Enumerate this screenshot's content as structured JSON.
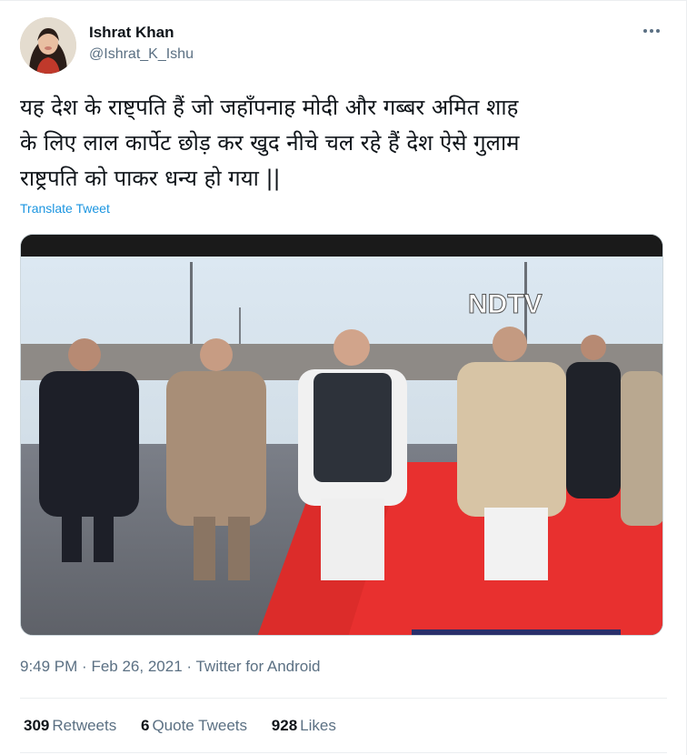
{
  "author": {
    "name": "Ishrat Khan",
    "handle": "@Ishrat_K_Ishu"
  },
  "tweet": {
    "line1": "यह देश के राष्ट्पति हैं जो जहाँपनाह मोदी और गब्बर अमित शाह",
    "line2": "के लिए लाल कार्पेट छोड़ कर खुद नीचे चल रहे हैं देश ऐसे गुलाम",
    "line3": "राष्ट्रपति को पाकर धन्य हो गया ||",
    "translate_label": "Translate Tweet"
  },
  "media": {
    "watermark": "NDTV"
  },
  "meta": {
    "time": "9:49 PM",
    "date": "Feb 26, 2021",
    "separator": "·",
    "source": "Twitter for Android"
  },
  "stats": {
    "retweets_count": "309",
    "retweets_label": "Retweets",
    "quotes_count": "6",
    "quotes_label": "Quote Tweets",
    "likes_count": "928",
    "likes_label": "Likes"
  },
  "colors": {
    "link": "#1b95e0",
    "secondary_text": "#5b7083",
    "primary_text": "#0f1419",
    "red_carpet": "#e8302f"
  },
  "icons": {
    "more": "more-dots-icon"
  }
}
